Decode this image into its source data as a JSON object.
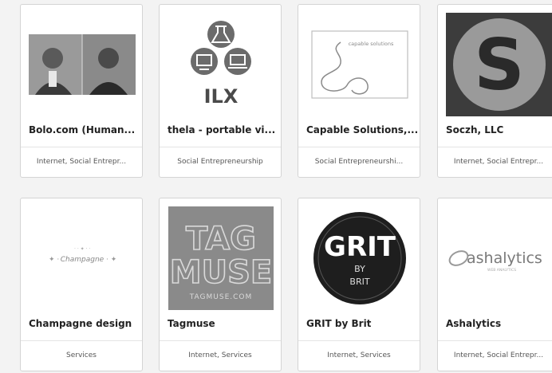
{
  "cards": [
    {
      "name": "Bolo.com (Human...",
      "category": "Internet, Social Entrepr..."
    },
    {
      "name": "thela - portable vi...",
      "category": "Social Entrepreneurship",
      "logo_text": "ILX"
    },
    {
      "name": "Capable Solutions,...",
      "category": "Social Entrepreneurshi...",
      "logo_text": "capable solutions"
    },
    {
      "name": "Soczh, LLC",
      "category": "Internet, Social Entrepr...",
      "logo_text": "S"
    },
    {
      "name": "Champagne design",
      "category": "Services",
      "logo_text": "Champagne"
    },
    {
      "name": "Tagmuse",
      "category": "Internet, Services",
      "logo_text_1": "TAG",
      "logo_text_2": "MUSE",
      "logo_text_3": "TAGMUSE.COM"
    },
    {
      "name": "GRIT by Brit",
      "category": "Internet, Services",
      "logo_text_1": "GRIT",
      "logo_text_2": "BY",
      "logo_text_3": "BRIT"
    },
    {
      "name": "Ashalytics",
      "category": "Internet, Social Entrepr...",
      "logo_text": "ashalytics",
      "logo_subtext": "WEB ANALYTICS"
    }
  ]
}
